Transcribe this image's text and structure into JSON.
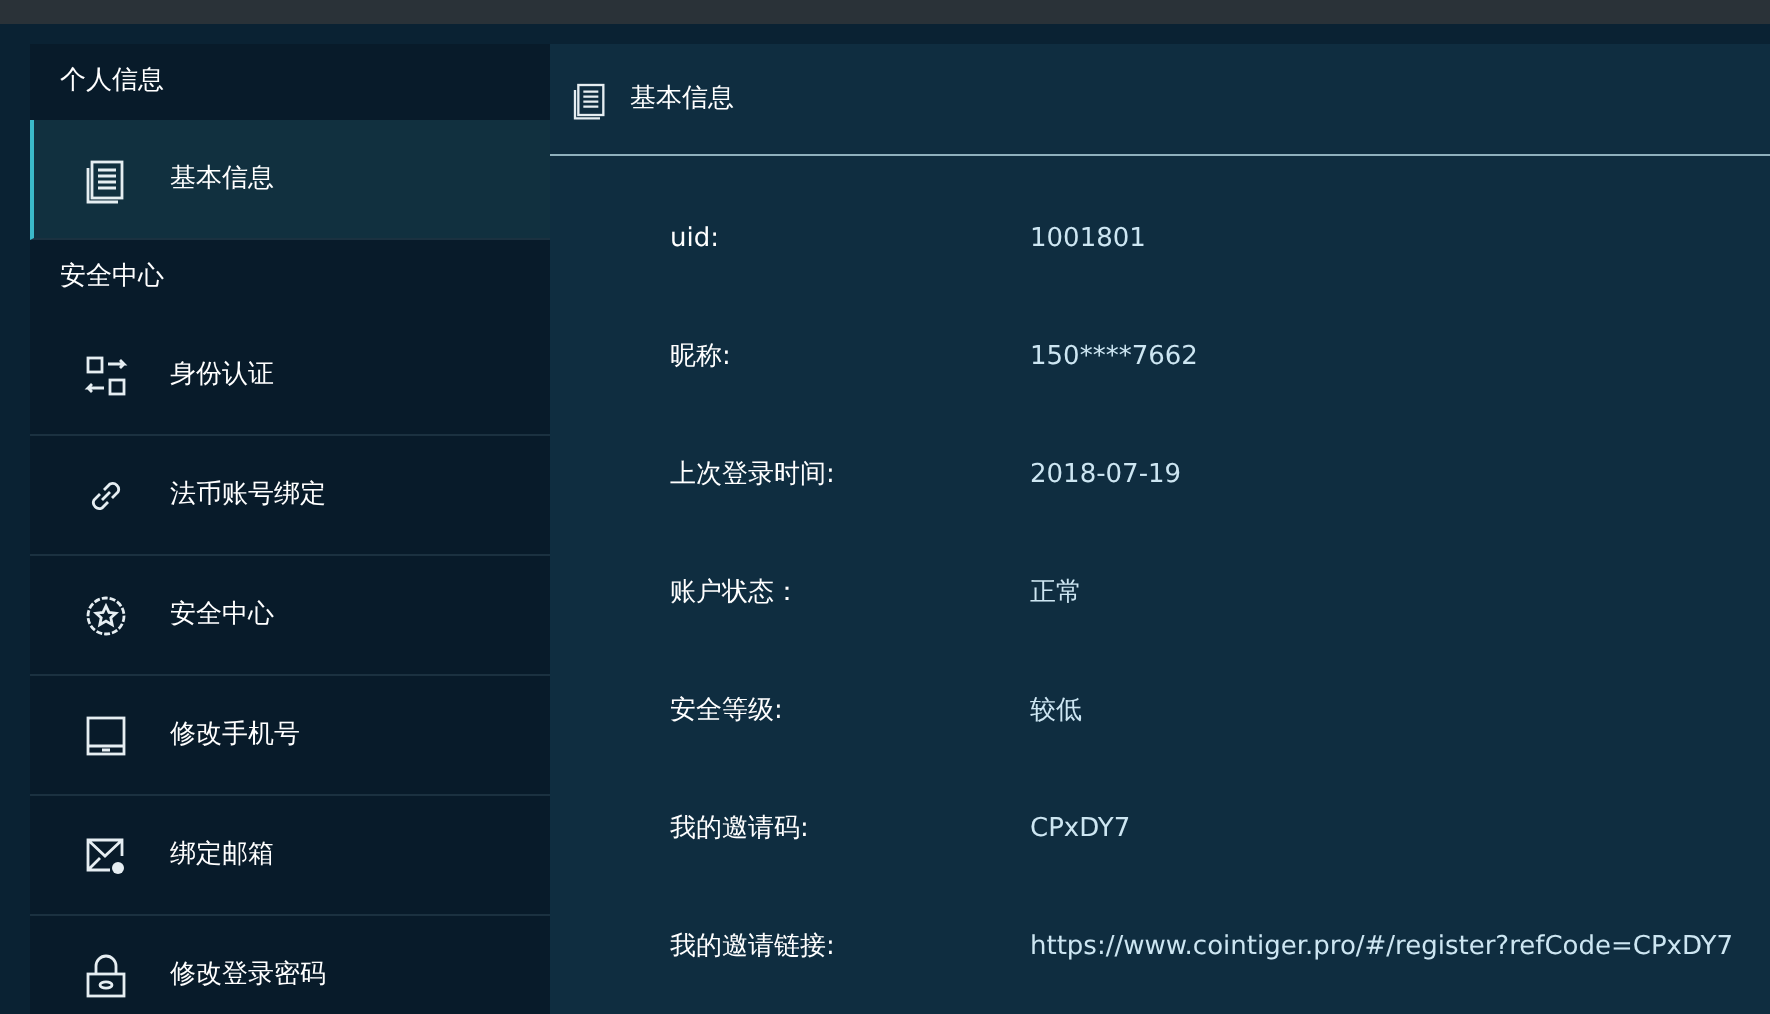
{
  "sidebar": {
    "sections": [
      {
        "title": "个人信息",
        "items": [
          {
            "label": "基本信息",
            "selected": true
          }
        ]
      },
      {
        "title": "安全中心",
        "items": [
          {
            "label": "身份认证",
            "selected": false
          },
          {
            "label": "法币账号绑定",
            "selected": false
          },
          {
            "label": "安全中心",
            "selected": false
          },
          {
            "label": "修改手机号",
            "selected": false
          },
          {
            "label": "绑定邮箱",
            "selected": false
          },
          {
            "label": "修改登录密码",
            "selected": false
          }
        ]
      }
    ]
  },
  "panel": {
    "title": "基本信息",
    "fields": [
      {
        "label": "uid:",
        "value": "1001801"
      },
      {
        "label": "昵称:",
        "value": "150****7662"
      },
      {
        "label": "上次登录时间:",
        "value": "2018-07-19"
      },
      {
        "label": "账户状态：",
        "value": "正常"
      },
      {
        "label": "安全等级:",
        "value": "较低"
      },
      {
        "label": "我的邀请码:",
        "value": "CPxDY7"
      },
      {
        "label": "我的邀请链接:",
        "value": "https://www.cointiger.pro/#/register?refCode=CPxDY7"
      }
    ]
  }
}
